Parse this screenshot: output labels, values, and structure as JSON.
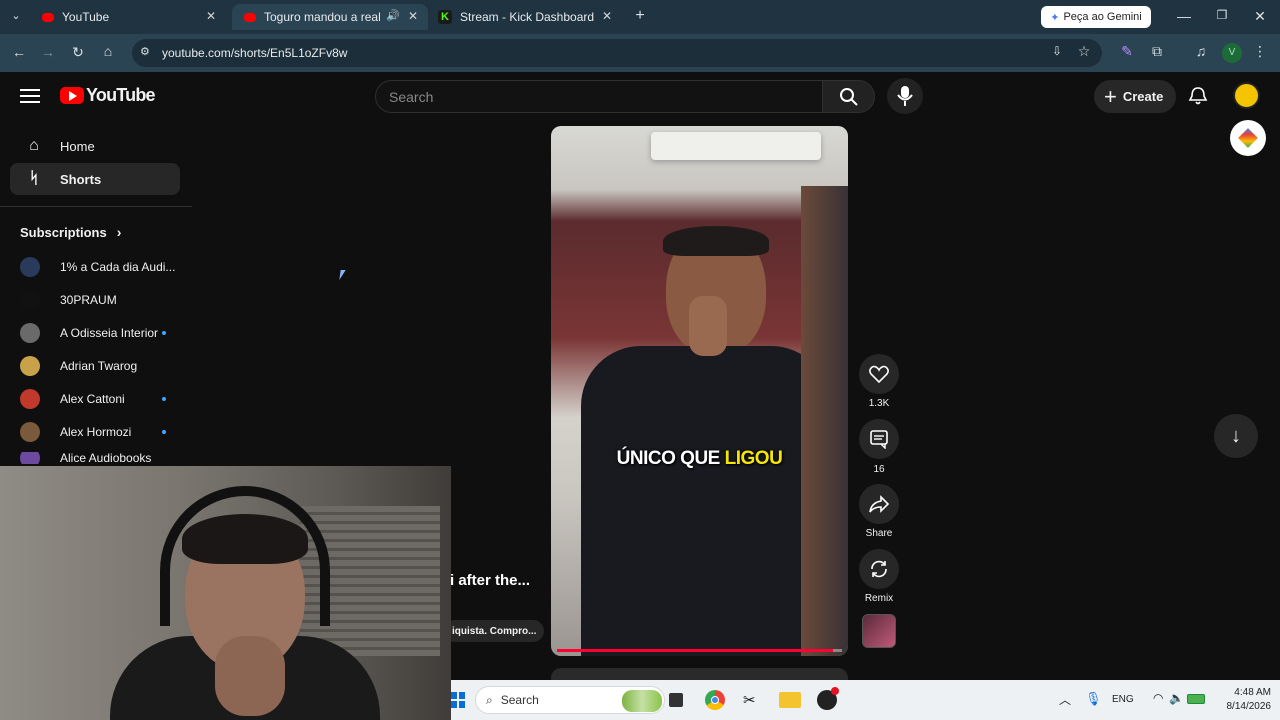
{
  "browser": {
    "tabs": [
      {
        "title": "YouTube",
        "favicon_color": "#ff0000"
      },
      {
        "title": "Toguro mandou a real pro",
        "favicon_color": "#ff0000"
      },
      {
        "title": "Stream - Kick Dashboard",
        "favicon_color": "#53fc18"
      }
    ],
    "gemini_button": "Peça ao Gemini",
    "url": "youtube.com/shorts/En5L1oZFv8w",
    "profile_initial": "V"
  },
  "youtube": {
    "logo_text": "YouTube",
    "search_placeholder": "Search",
    "create_label": "Create",
    "nav": [
      {
        "label": "Home",
        "icon": "home-icon"
      },
      {
        "label": "Shorts",
        "icon": "shorts-icon"
      }
    ],
    "subscriptions_label": "Subscriptions",
    "subscriptions": [
      {
        "name": "1% a Cada dia Audi...",
        "new": false,
        "color": "#2a3a5a"
      },
      {
        "name": "30PRAUM",
        "new": false,
        "color": "#111111"
      },
      {
        "name": "A Odisseia Interior",
        "new": true,
        "color": "#6a6a6a"
      },
      {
        "name": "Adrian Twarog",
        "new": false,
        "color": "#c8a24a"
      },
      {
        "name": "Alex Cattoni",
        "new": true,
        "color": "#c0392b"
      },
      {
        "name": "Alex Hormozi",
        "new": true,
        "color": "#7a5a3a"
      },
      {
        "name": "Alice Audiobooks",
        "new": false,
        "color": "#6b4aa0"
      }
    ],
    "short": {
      "caption_word1": "ÚNICO QUE",
      "caption_word2": "LIGOU",
      "left_title": "i after the...",
      "left_chip": "iquista. Compro...",
      "progress": 0.97,
      "actions": {
        "like_count": "1.3K",
        "comment_count": "16",
        "share_label": "Share",
        "remix_label": "Remix"
      }
    }
  },
  "taskbar": {
    "search_label": "Search",
    "lang": "ENG",
    "time": "4:48 AM",
    "date": "8/14/2026"
  }
}
